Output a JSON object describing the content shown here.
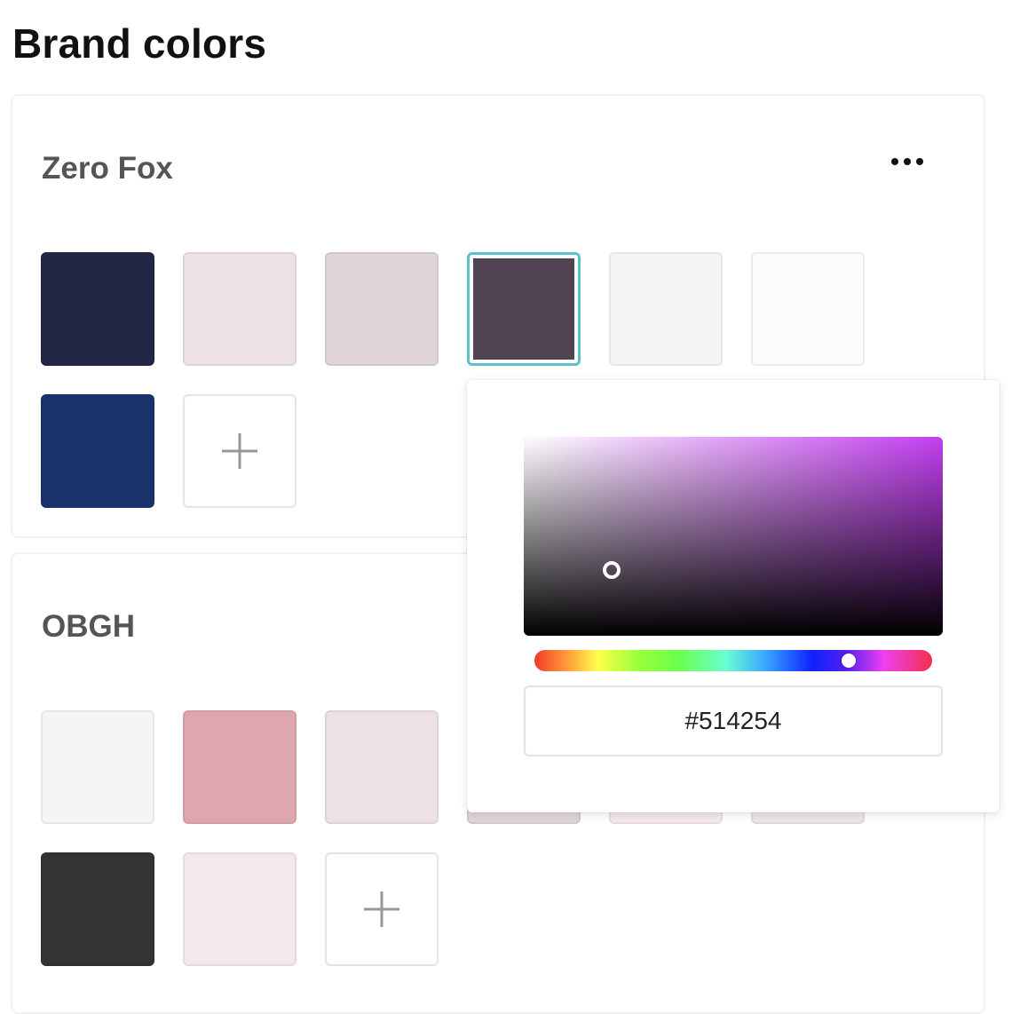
{
  "page": {
    "title": "Brand colors"
  },
  "palettes": [
    {
      "name": "Zero Fox",
      "more_icon": "more-horizontal-icon",
      "swatches": [
        "#232746",
        "#ede0e6",
        "#e0d4d7",
        "#514254",
        "#f5f5f5",
        "#fdfafa",
        "#1b336d"
      ],
      "selected_index": 3,
      "add_icon": "plus-icon"
    },
    {
      "name": "OBGH",
      "swatches": [
        "#f5f5f5",
        "#dea7b0",
        "#ede0e6",
        "#e0d4d7",
        "#f3e9ea",
        "#ece6e5",
        "#333333",
        "#f3e9ea"
      ],
      "add_icon": "plus-icon"
    }
  ],
  "color_picker": {
    "hex_value": "#514254",
    "hue_color": "#c23ff0",
    "saturation": 0.21,
    "value": 0.33,
    "hue_position": 0.79
  }
}
